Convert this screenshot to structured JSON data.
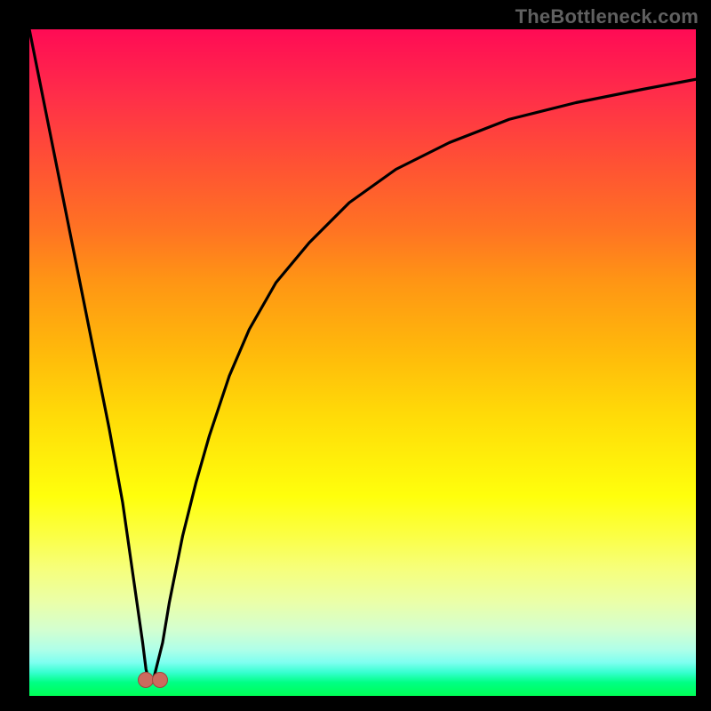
{
  "watermark": "TheBottleneck.com",
  "colors": {
    "frame": "#000000",
    "curve_stroke": "#000000",
    "marker_fill": "#cc6a5e",
    "marker_border": "#a0483f"
  },
  "chart_data": {
    "type": "line",
    "title": "",
    "xlabel": "",
    "ylabel": "",
    "xlim": [
      0,
      100
    ],
    "ylim": [
      0,
      100
    ],
    "grid": false,
    "legend": false,
    "series": [
      {
        "name": "bottleneck-curve",
        "x": [
          0,
          2,
          4,
          6,
          8,
          10,
          12,
          14,
          15,
          16,
          17,
          17.5,
          18,
          18.5,
          19,
          20,
          21,
          22,
          23,
          25,
          27,
          30,
          33,
          37,
          42,
          48,
          55,
          63,
          72,
          82,
          92,
          100
        ],
        "y": [
          100,
          90,
          80,
          70,
          60,
          50,
          40,
          29,
          22,
          15,
          8,
          4,
          2,
          2,
          4,
          8,
          14,
          19,
          24,
          32,
          39,
          48,
          55,
          62,
          68,
          74,
          79,
          83,
          86.5,
          89,
          91,
          92.5
        ]
      }
    ],
    "markers": [
      {
        "x": 17.3,
        "y": 2.5
      },
      {
        "x": 19.5,
        "y": 2.5
      }
    ],
    "gradient_stops": [
      {
        "pos": 0,
        "color": "#ff0b55"
      },
      {
        "pos": 0.7,
        "color": "#ffff0c"
      },
      {
        "pos": 1.0,
        "color": "#00ff56"
      }
    ]
  }
}
